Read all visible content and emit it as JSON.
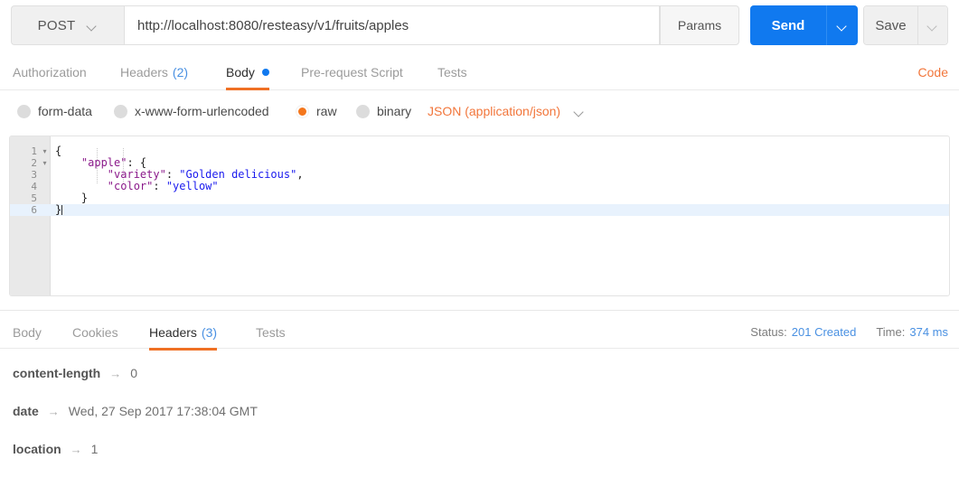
{
  "request": {
    "method": "POST",
    "url": "http://localhost:8080/resteasy/v1/fruits/apples",
    "params_label": "Params",
    "send_label": "Send",
    "save_label": "Save",
    "code_label": "Code",
    "tabs": [
      {
        "label": "Authorization",
        "count": "",
        "active": false
      },
      {
        "label": "Headers",
        "count": "(2)",
        "active": false
      },
      {
        "label": "Body",
        "count": "",
        "active": true
      },
      {
        "label": "Pre-request Script",
        "count": "",
        "active": false
      },
      {
        "label": "Tests",
        "count": "",
        "active": false
      }
    ],
    "body_types": [
      {
        "label": "form-data",
        "selected": false
      },
      {
        "label": "x-www-form-urlencoded",
        "selected": false
      },
      {
        "label": "raw",
        "selected": true
      },
      {
        "label": "binary",
        "selected": false
      }
    ],
    "content_type": "JSON (application/json)",
    "editor": {
      "lines": [
        {
          "num": "1",
          "fold": "▾",
          "active": false,
          "tokens": [
            {
              "t": "{",
              "c": "tk-punct"
            }
          ]
        },
        {
          "num": "2",
          "fold": "▾",
          "active": false,
          "tokens": [
            {
              "t": "    ",
              "c": "tk-punct"
            },
            {
              "t": "\"apple\"",
              "c": "tk-key"
            },
            {
              "t": ": {",
              "c": "tk-punct"
            }
          ]
        },
        {
          "num": "3",
          "fold": "",
          "active": false,
          "tokens": [
            {
              "t": "        ",
              "c": "tk-punct"
            },
            {
              "t": "\"variety\"",
              "c": "tk-key"
            },
            {
              "t": ": ",
              "c": "tk-punct"
            },
            {
              "t": "\"Golden delicious\"",
              "c": "tk-str"
            },
            {
              "t": ",",
              "c": "tk-punct"
            }
          ]
        },
        {
          "num": "4",
          "fold": "",
          "active": false,
          "tokens": [
            {
              "t": "        ",
              "c": "tk-punct"
            },
            {
              "t": "\"color\"",
              "c": "tk-key"
            },
            {
              "t": ": ",
              "c": "tk-punct"
            },
            {
              "t": "\"yellow\"",
              "c": "tk-str"
            }
          ]
        },
        {
          "num": "5",
          "fold": "",
          "active": false,
          "tokens": [
            {
              "t": "    }",
              "c": "tk-punct"
            }
          ]
        },
        {
          "num": "6",
          "fold": "",
          "active": true,
          "tokens": [
            {
              "t": "}",
              "c": "tk-punct"
            }
          ]
        }
      ]
    }
  },
  "response": {
    "tabs": [
      {
        "label": "Body",
        "count": "",
        "active": false
      },
      {
        "label": "Cookies",
        "count": "",
        "active": false
      },
      {
        "label": "Headers",
        "count": "(3)",
        "active": true
      },
      {
        "label": "Tests",
        "count": "",
        "active": false
      }
    ],
    "status_label": "Status:",
    "status_value": "201 Created",
    "time_label": "Time:",
    "time_value": "374 ms",
    "headers": [
      {
        "key": "content-length",
        "arrow": "→",
        "value": "0"
      },
      {
        "key": "date",
        "arrow": "→",
        "value": "Wed, 27 Sep 2017 17:38:04 GMT"
      },
      {
        "key": "location",
        "arrow": "→",
        "value": "1"
      }
    ]
  },
  "colors": {
    "accent_orange": "#ef7024",
    "accent_blue": "#1079ef",
    "link_blue": "#4990e2",
    "key_purple": "#8b1a8b",
    "string_blue": "#1a1aee"
  }
}
